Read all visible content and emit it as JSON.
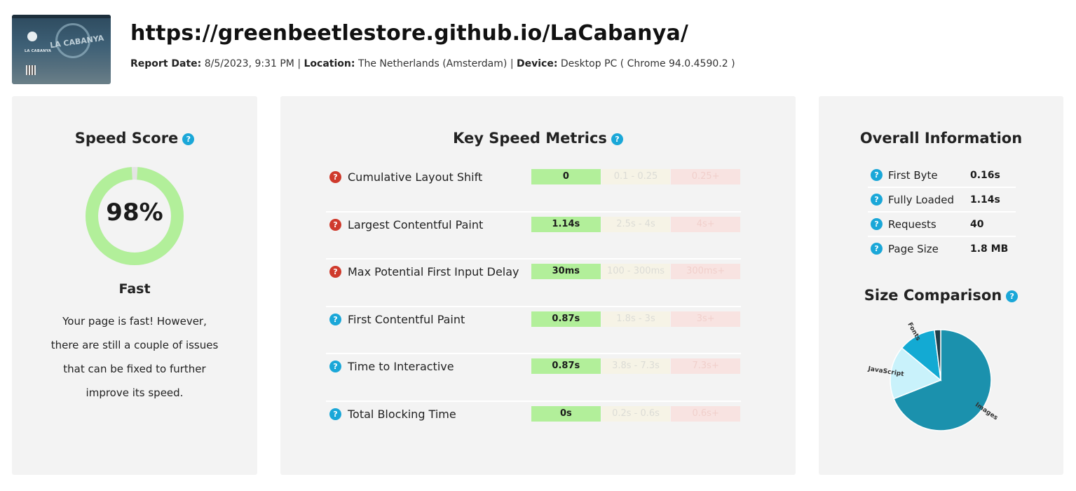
{
  "header": {
    "url": "https://greenbeetlestore.github.io/LaCabanya/",
    "report_date_label": "Report Date:",
    "report_date": "8/5/2023, 9:31 PM",
    "location_label": "Location:",
    "location": "The Netherlands (Amsterdam)",
    "device_label": "Device:",
    "device": "Desktop PC ( Chrome 94.0.4590.2 )",
    "separator": "|",
    "thumbnail_brand": "LA CABANYA"
  },
  "speed_score": {
    "title": "Speed Score",
    "value": "98%",
    "percent": 98,
    "grade": "Fast",
    "description": "Your page is fast! However, there are still a couple of issues that can be fixed to further improve its speed.",
    "ring_color": "#b2ef9a",
    "ring_track_color": "#e4e4e4"
  },
  "key_metrics": {
    "title": "Key Speed Metrics",
    "rows": [
      {
        "name": "Cumulative Layout Shift",
        "icon": "question-icon-red",
        "good": "0",
        "mid": "0.1 - 0.25",
        "bad": "0.25+"
      },
      {
        "name": "Largest Contentful Paint",
        "icon": "question-icon-red",
        "good": "1.14s",
        "mid": "2.5s - 4s",
        "bad": "4s+"
      },
      {
        "name": "Max Potential First Input Delay",
        "icon": "question-icon-red",
        "good": "30ms",
        "mid": "100 - 300ms",
        "bad": "300ms+"
      },
      {
        "name": "First Contentful Paint",
        "icon": "question-icon-blue",
        "good": "0.87s",
        "mid": "1.8s - 3s",
        "bad": "3s+"
      },
      {
        "name": "Time to Interactive",
        "icon": "question-icon-blue",
        "good": "0.87s",
        "mid": "3.8s - 7.3s",
        "bad": "7.3s+"
      },
      {
        "name": "Total Blocking Time",
        "icon": "question-icon-blue",
        "good": "0s",
        "mid": "0.2s - 0.6s",
        "bad": "0.6s+"
      }
    ]
  },
  "overall": {
    "title": "Overall Information",
    "rows": [
      {
        "label": "First Byte",
        "value": "0.16s"
      },
      {
        "label": "Fully Loaded",
        "value": "1.14s"
      },
      {
        "label": "Requests",
        "value": "40"
      },
      {
        "label": "Page Size",
        "value": "1.8 MB"
      }
    ]
  },
  "size_comparison": {
    "title": "Size Comparison",
    "chart_data": {
      "type": "pie",
      "slices": [
        {
          "label": "Images",
          "value": 69,
          "color": "#1b91ad"
        },
        {
          "label": "JavaScript",
          "value": 17,
          "color": "#c9f2fb"
        },
        {
          "label": "Fonts",
          "value": 12,
          "color": "#13aad3"
        },
        {
          "label": "",
          "value": 2,
          "color": "#1f3e4a"
        }
      ]
    }
  },
  "question_mark": "?"
}
